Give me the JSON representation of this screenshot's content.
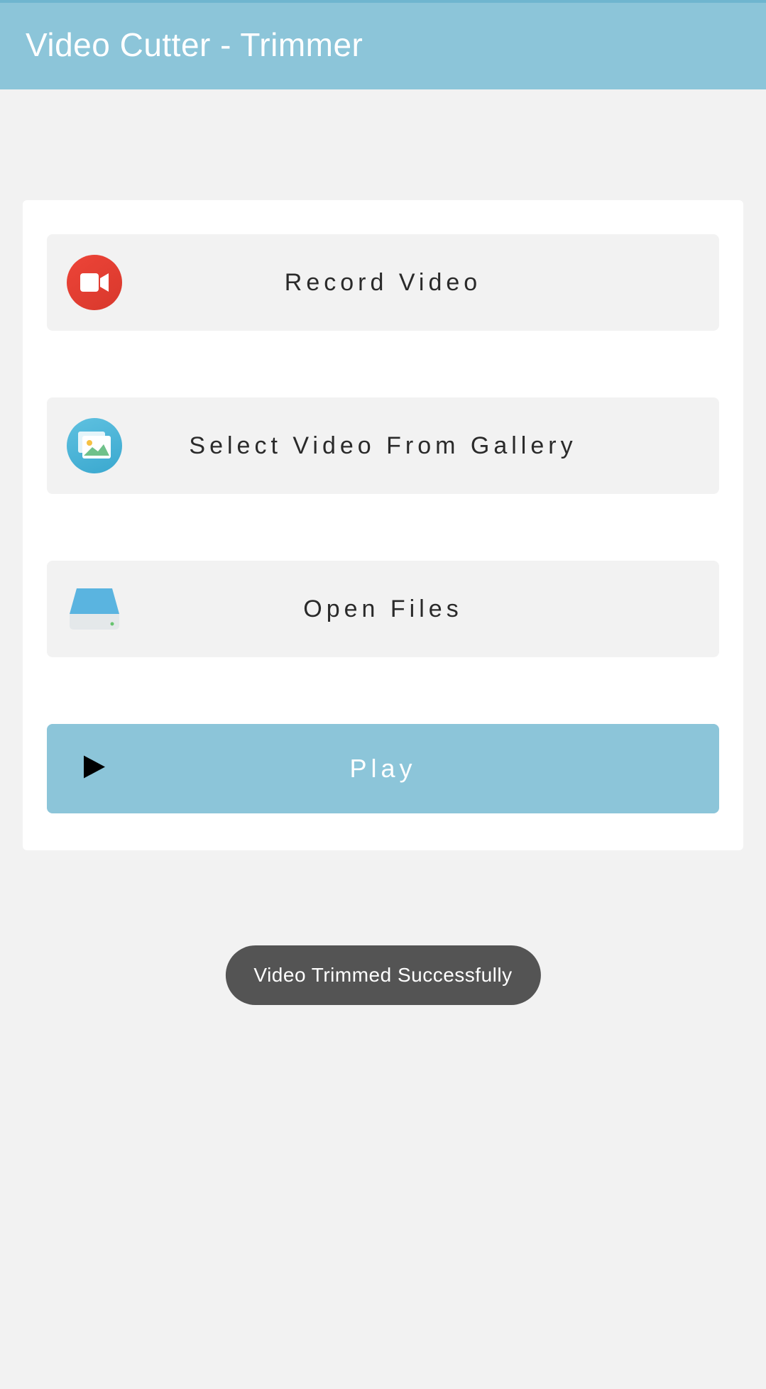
{
  "header": {
    "title": "Video Cutter - Trimmer"
  },
  "options": {
    "record": "Record Video",
    "gallery": "Select Video From Gallery",
    "files": "Open Files",
    "play": "Play"
  },
  "toast": {
    "message": "Video Trimmed Successfully"
  }
}
